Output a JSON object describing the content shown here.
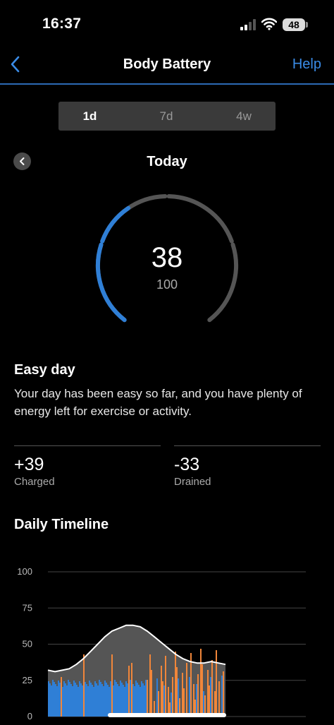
{
  "status_bar": {
    "time": "16:37",
    "battery": "48"
  },
  "nav": {
    "title": "Body Battery",
    "help": "Help"
  },
  "tabs": [
    {
      "label": "1d",
      "selected": true
    },
    {
      "label": "7d",
      "selected": false
    },
    {
      "label": "4w",
      "selected": false
    }
  ],
  "day_header": {
    "label": "Today"
  },
  "gauge": {
    "value": "38",
    "max": "100",
    "fill_fraction": 0.38,
    "accent": "#2f7fd6",
    "track": "#555555"
  },
  "summary": {
    "title": "Easy day",
    "description": "Your day has been easy so far, and you have plenty of energy left for exercise or activity."
  },
  "stats": {
    "charged": {
      "value": "+39",
      "label": "Charged"
    },
    "drained": {
      "value": "-33",
      "label": "Drained"
    }
  },
  "timeline": {
    "title": "Daily Timeline"
  },
  "chart_data": {
    "type": "area",
    "y_ticks": [
      "100",
      "75",
      "50",
      "25",
      "0"
    ],
    "ylim": [
      0,
      100
    ],
    "level_series": [
      32,
      31,
      32,
      33,
      36,
      40,
      45,
      50,
      55,
      59,
      61,
      63,
      63,
      62,
      59,
      55,
      51,
      47,
      43,
      40,
      38,
      37,
      37,
      38,
      37,
      36
    ],
    "colors": {
      "charge": "#2f7fd6",
      "stress": "#f0863a",
      "line": "#ffffff",
      "fill": "#555555",
      "grid": "#444444"
    }
  }
}
